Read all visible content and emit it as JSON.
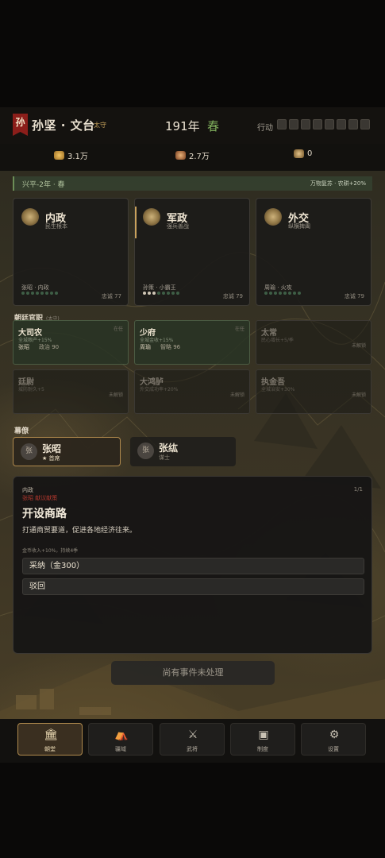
{
  "header": {
    "banner": "孙",
    "ruler": "孙坚 · 文台",
    "rank": "太守",
    "year": "191年",
    "season": "春",
    "action_label": "行动",
    "action_slots": 8
  },
  "resources": [
    {
      "icon": "gold-icon",
      "value": "3.1万",
      "sub": "",
      "color": "#d6a24e"
    },
    {
      "icon": "granary-icon",
      "value": "2.7万",
      "sub": "",
      "color": "#c07a3a"
    },
    {
      "icon": "horse-icon",
      "value": "0",
      "sub": "",
      "color": "#d6a24e"
    }
  ],
  "era": {
    "left": "兴平-2年 · 春",
    "right": "万物复苏 · 农耕+20%"
  },
  "departments": [
    {
      "title": "内政",
      "sub": "民生根本",
      "who": "张昭 · 内政",
      "loyalty": "忠诚 77",
      "dots_on": 0
    },
    {
      "title": "军政",
      "sub": "强兵善战",
      "who": "孙策 · 小霸王",
      "loyalty": "忠诚 79",
      "dots_on": 3
    },
    {
      "title": "外交",
      "sub": "纵横捭阖",
      "who": "周瑜 · 火攻",
      "loyalty": "忠诚 79",
      "dots_on": 0
    }
  ],
  "court": {
    "title": "朝廷官职",
    "hint": "(太守)"
  },
  "offices": [
    {
      "name": "大司农",
      "desc": "全城粮产+15%",
      "holder": "张昭",
      "stat": "政治 90",
      "tag": "在任",
      "filled": true
    },
    {
      "name": "少府",
      "desc": "全城金收+15%",
      "holder": "周瑜",
      "stat": "智略 96",
      "tag": "在任",
      "filled": true
    },
    {
      "name": "太常",
      "desc": "民心增长+5/季",
      "holder": "",
      "stat": "",
      "tag": "未解锁",
      "filled": false
    },
    {
      "name": "廷尉",
      "desc": "城防耐久+5",
      "holder": "",
      "stat": "",
      "tag": "未解锁",
      "filled": false
    },
    {
      "name": "大鸿胪",
      "desc": "外交成功率+20%",
      "holder": "",
      "stat": "",
      "tag": "未解锁",
      "filled": false
    },
    {
      "name": "执金吾",
      "desc": "全城治安+30%",
      "holder": "",
      "stat": "",
      "tag": "未解锁",
      "filled": false
    }
  ],
  "advisors_title": "幕僚",
  "advisors": [
    {
      "avatar": "张",
      "name": "张昭",
      "role": "★ 首席",
      "selected": true
    },
    {
      "avatar": "张",
      "name": "张纮",
      "role": "谋士",
      "selected": false
    }
  ],
  "event": {
    "category": "内政",
    "source": "张昭 献议献策",
    "page": "1/1",
    "title": "开设商路",
    "desc": "打通商贸要道，促进各地经济往来。",
    "effect": "金币收入+10%，持续4季",
    "choices": [
      "采纳（金300）",
      "驳回"
    ]
  },
  "pending": "尚有事件未处理",
  "nav": [
    {
      "label": "朝堂",
      "icon": "hall-icon",
      "active": true
    },
    {
      "label": "疆域",
      "icon": "territory-icon",
      "active": false
    },
    {
      "label": "武将",
      "icon": "generals-icon",
      "active": false
    },
    {
      "label": "制度",
      "icon": "system-icon",
      "active": false
    },
    {
      "label": "设置",
      "icon": "settings-icon",
      "active": false
    }
  ]
}
